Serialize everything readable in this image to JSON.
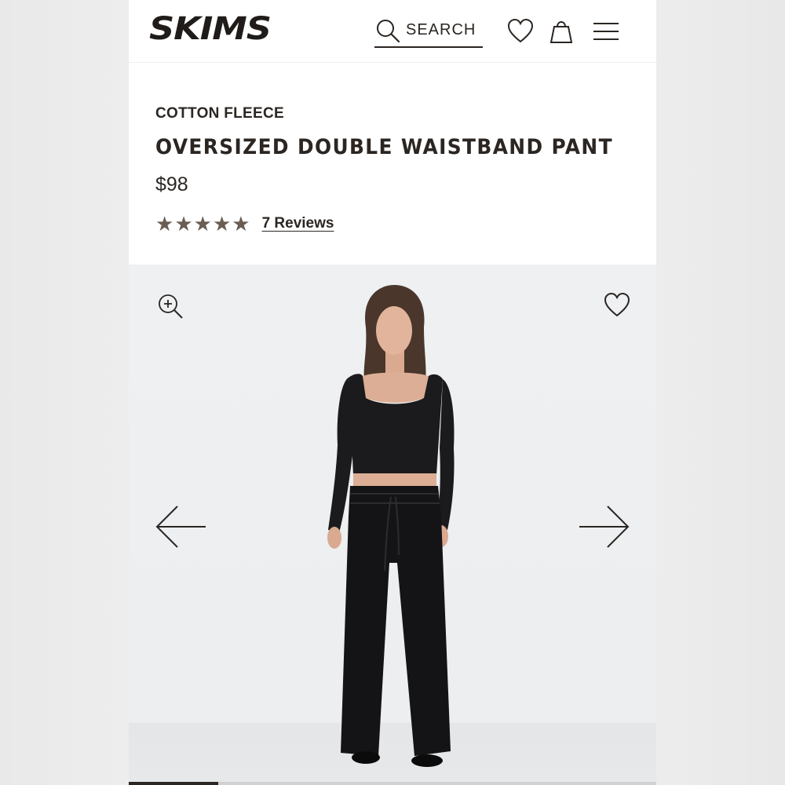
{
  "header": {
    "logo": "SKIMS",
    "search_label": "SEARCH"
  },
  "product": {
    "collection": "COTTON FLEECE",
    "title": "OVERSIZED DOUBLE WAISTBAND PANT",
    "price": "$98",
    "rating": 5,
    "reviews_label": "7 Reviews"
  },
  "gallery": {
    "image_index": 1,
    "progress": 0.17
  },
  "colors": {
    "text": "#2b2622",
    "star": "#6a5d53",
    "gallery_bg": "#eef0f2"
  }
}
